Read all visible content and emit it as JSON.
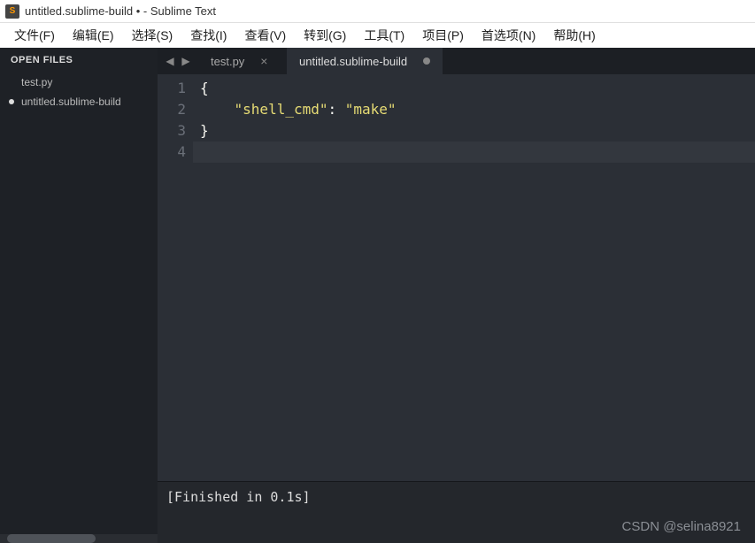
{
  "window": {
    "title": "untitled.sublime-build • - Sublime Text",
    "icon_letter": "S"
  },
  "menubar": {
    "items": [
      "文件(F)",
      "编辑(E)",
      "选择(S)",
      "查找(I)",
      "查看(V)",
      "转到(G)",
      "工具(T)",
      "项目(P)",
      "首选项(N)",
      "帮助(H)"
    ]
  },
  "sidebar": {
    "header": "OPEN FILES",
    "files": [
      {
        "name": "test.py",
        "modified": false
      },
      {
        "name": "untitled.sublime-build",
        "modified": true
      }
    ]
  },
  "tabs": {
    "nav_prev": "◀",
    "nav_next": "▶",
    "items": [
      {
        "label": "test.py",
        "active": false,
        "dirty": false
      },
      {
        "label": "untitled.sublime-build",
        "active": true,
        "dirty": true
      }
    ]
  },
  "editor": {
    "lines": [
      {
        "n": "1",
        "tokens": [
          {
            "t": "{",
            "c": "punct"
          }
        ]
      },
      {
        "n": "2",
        "tokens": [
          {
            "t": "    ",
            "c": ""
          },
          {
            "t": "\"shell_cmd\"",
            "c": "key"
          },
          {
            "t": ": ",
            "c": "punct"
          },
          {
            "t": "\"make\"",
            "c": "string"
          }
        ]
      },
      {
        "n": "3",
        "tokens": [
          {
            "t": "}",
            "c": "punct"
          }
        ]
      },
      {
        "n": "4",
        "tokens": [],
        "cursor": true
      }
    ]
  },
  "console": {
    "output": "[Finished in 0.1s]"
  },
  "watermark": "CSDN @selina8921"
}
